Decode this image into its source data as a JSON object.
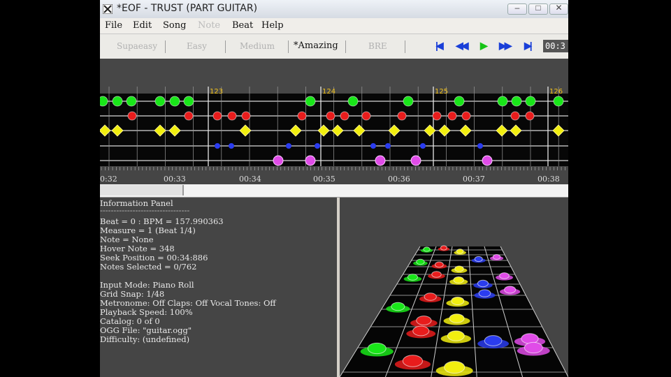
{
  "window": {
    "title": "*EOF - TRUST (PART GUITAR)"
  },
  "menu": [
    {
      "label": "File",
      "enabled": true
    },
    {
      "label": "Edit",
      "enabled": true
    },
    {
      "label": "Song",
      "enabled": true
    },
    {
      "label": "Note",
      "enabled": false
    },
    {
      "label": "Beat",
      "enabled": true
    },
    {
      "label": "Help",
      "enabled": true
    }
  ],
  "difficulty_tabs": [
    {
      "label": "Supaeasy",
      "active": false
    },
    {
      "label": "Easy",
      "active": false
    },
    {
      "label": "Medium",
      "active": false
    },
    {
      "label": "*Amazing",
      "active": true
    },
    {
      "label": "BRE",
      "active": false
    }
  ],
  "transport": {
    "time": "00:3",
    "buttons": [
      "rewind-to-start",
      "rewind",
      "play",
      "fast-forward",
      "seek-to-end"
    ]
  },
  "roll": {
    "measure_labels": [
      "123",
      "124",
      "125",
      "126"
    ],
    "time_labels": [
      "0:32",
      "00:33",
      "00:34",
      "00:35",
      "00:36",
      "00:37",
      "00:38"
    ],
    "lane_colors": [
      "#19e619",
      "#e81c1c",
      "#f2ef10",
      "#2a3cf0",
      "#e04ce8"
    ]
  },
  "info_panel": {
    "lines": [
      "Information Panel",
      "---------------------------------",
      "Beat = 0 : BPM = 157.990363",
      "Measure = 1 (Beat 1/4)",
      "Note = None",
      "Hover Note = 348",
      "Seek Position = 00:34:886",
      "Notes Selected = 0/762",
      "",
      "Input Mode: Piano Roll",
      "Grid Snap: 1/48",
      "Metronome: Off Claps: Off Vocal Tones: Off",
      "Playback Speed: 100%",
      "Catalog: 0 of 0",
      "OGG File: \"guitar.ogg\"",
      "Difficulty: (undefined)"
    ]
  }
}
